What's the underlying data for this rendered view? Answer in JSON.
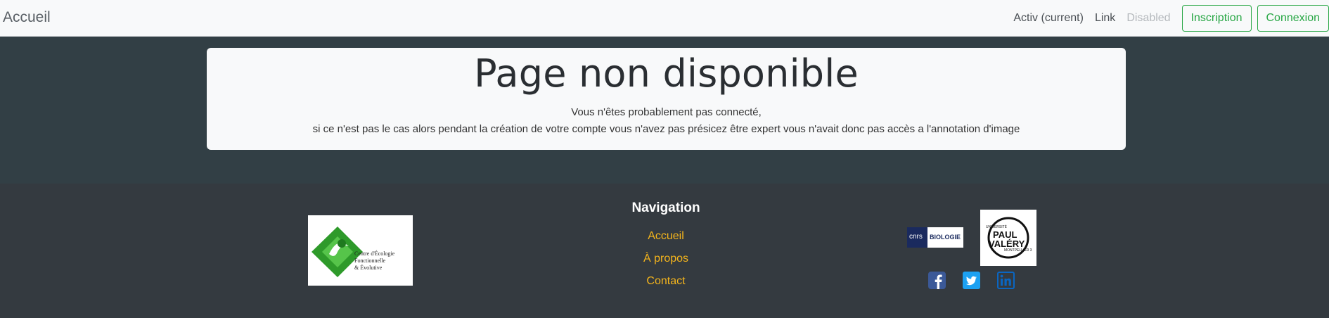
{
  "navbar": {
    "brand": "Accueil",
    "links": [
      "Activ (current)",
      "Link",
      "Disabled"
    ],
    "btn_signup": "Inscription",
    "btn_login": "Connexion"
  },
  "card": {
    "title": "Page non disponible",
    "line1": "Vous n'êtes probablement pas connecté,",
    "line2": "si ce n'est pas le cas alors pendant la création de votre compte vous n'avez pas présicez être expert vous n'avait donc pas accès a l'annotation d'image"
  },
  "footer": {
    "nav_heading": "Navigation",
    "nav_links": [
      "Accueil",
      "À propos",
      "Contact"
    ],
    "cefe_logo": {
      "line1": "Centre d'Écologie",
      "line2": "Fonctionnelle",
      "line3": "& Évolutive"
    },
    "cnrs_logo": {
      "mark": "cnrs",
      "text": "BIOLOGIE"
    },
    "upv_logo": {
      "top": "UNIVERSITÉ",
      "name1": "PAUL",
      "name2": "VALÉRY",
      "bottom": "MONTPELLIER 3"
    },
    "social": [
      "facebook-icon",
      "twitter-icon",
      "linkedin-icon"
    ]
  },
  "colors": {
    "accent_green": "#28a745",
    "footer_link": "#f5b51c",
    "footer_bg": "#343a40",
    "band_bg": "#323f45"
  }
}
